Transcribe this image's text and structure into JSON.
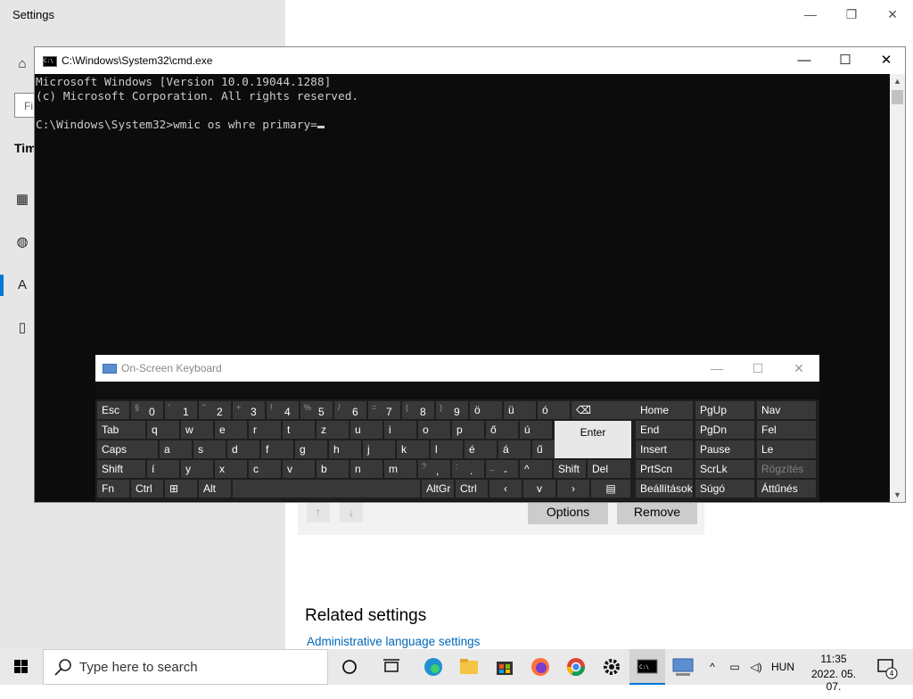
{
  "settings": {
    "title": "Settings",
    "search_partial": "Fi",
    "section_partial": "Tim",
    "options_label": "Options",
    "remove_label": "Remove",
    "related_title": "Related settings",
    "admin_link": "Administrative language settings"
  },
  "cmd": {
    "title": "C:\\Windows\\System32\\cmd.exe",
    "icon_text": "C:\\",
    "lines": [
      "Microsoft Windows [Version 10.0.19044.1288]",
      "(c) Microsoft Corporation. All rights reserved.",
      "",
      "C:\\Windows\\System32>wmic os whre primary="
    ]
  },
  "osk": {
    "title": "On-Screen Keyboard",
    "row1": [
      {
        "pri": "Esc"
      },
      {
        "sec": "§",
        "pri": "0"
      },
      {
        "sec": "'",
        "pri": "1"
      },
      {
        "sec": "\"",
        "pri": "2"
      },
      {
        "sec": "+",
        "pri": "3"
      },
      {
        "sec": "!",
        "pri": "4"
      },
      {
        "sec": "%",
        "pri": "5"
      },
      {
        "sec": "/",
        "pri": "6"
      },
      {
        "sec": "=",
        "pri": "7"
      },
      {
        "sec": "(",
        "pri": "8"
      },
      {
        "sec": ")",
        "pri": "9"
      },
      {
        "pri": "ö"
      },
      {
        "pri": "ü"
      },
      {
        "pri": "ó"
      },
      {
        "pri": "⌫"
      }
    ],
    "row2": [
      "Tab",
      "q",
      "w",
      "e",
      "r",
      "t",
      "z",
      "u",
      "i",
      "o",
      "p",
      "ő",
      "ú"
    ],
    "row3": [
      "Caps",
      "a",
      "s",
      "d",
      "f",
      "g",
      "h",
      "j",
      "k",
      "l",
      "é",
      "á",
      "ű"
    ],
    "row4": [
      {
        "pri": "Shift"
      },
      {
        "pri": "í"
      },
      {
        "pri": "y"
      },
      {
        "pri": "x"
      },
      {
        "pri": "c"
      },
      {
        "pri": "v"
      },
      {
        "pri": "b"
      },
      {
        "pri": "n"
      },
      {
        "pri": "m"
      },
      {
        "sec": "?",
        "pri": ","
      },
      {
        "sec": ":",
        "pri": "."
      },
      {
        "sec": "_",
        "pri": "-"
      },
      {
        "pri": "^"
      },
      {
        "pri": "Shift"
      },
      {
        "pri": "Del"
      }
    ],
    "row5": [
      "Fn",
      "Ctrl",
      "⊞",
      "Alt",
      "",
      "AltGr",
      "Ctrl",
      "‹",
      "v",
      "›",
      "▤"
    ],
    "enter": "Enter",
    "nav": [
      [
        "Home",
        "PgUp",
        "Nav"
      ],
      [
        "End",
        "PgDn",
        "Fel"
      ],
      [
        "Insert",
        "Pause",
        "Le"
      ],
      [
        "PrtScn",
        "ScrLk",
        "Rögzítés"
      ],
      [
        "Beállítások",
        "Súgó",
        "Áttűnés"
      ]
    ]
  },
  "taskbar": {
    "search_placeholder": "Type here to search",
    "language": "HUN",
    "time": "11:35",
    "date": "2022. 05. 07.",
    "notification_count": "4"
  }
}
